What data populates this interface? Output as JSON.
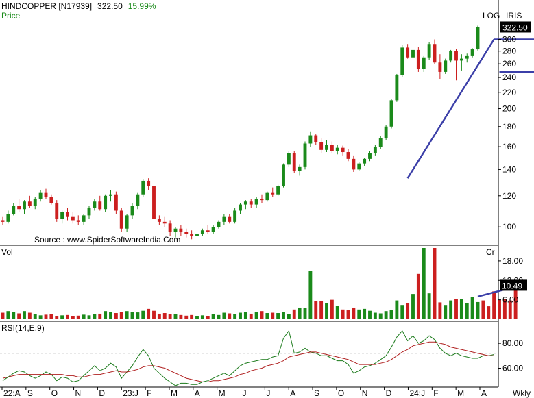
{
  "header": {
    "symbol": "HINDCOPPER [N17939]",
    "last_price": "322.50",
    "change_pct": "15.99%",
    "price_label": "Price",
    "log_label": "LOG",
    "iris_label": "IRIS"
  },
  "watermark": "Source : www.SpiderSoftwareIndia.Com",
  "colors": {
    "up": "#1a8a1a",
    "down": "#cc1f1f",
    "trend": "#3b3fa8",
    "rsi": "#1a7a1a",
    "rsi_avg": "#b02020",
    "badge": "#000000"
  },
  "chart_data": [
    {
      "type": "candlestick",
      "title": "HINDCOPPER [N17939]",
      "scale": "log",
      "ylim": [
        92,
        335
      ],
      "yticks": [
        "300",
        "280",
        "260",
        "240",
        "220",
        "200",
        "180",
        "160",
        "140",
        "120",
        "100"
      ],
      "last_value": "322.50",
      "time_labels": [
        "22:A",
        "S",
        "O",
        "N",
        "D",
        "23:J",
        "F",
        "M",
        "A",
        "M",
        "J",
        "J",
        "A",
        "S",
        "O",
        "N",
        "D",
        "24:J",
        "F",
        "M",
        "A"
      ],
      "x_unit": "Wkly",
      "bars": [
        [
          104,
          106,
          101,
          103
        ],
        [
          103,
          110,
          102,
          108
        ],
        [
          108,
          115,
          107,
          113
        ],
        [
          113,
          118,
          109,
          111
        ],
        [
          111,
          117,
          108,
          116
        ],
        [
          116,
          120,
          112,
          113
        ],
        [
          113,
          119,
          111,
          118
        ],
        [
          118,
          124,
          116,
          122
        ],
        [
          122,
          125,
          118,
          119
        ],
        [
          119,
          121,
          114,
          115
        ],
        [
          115,
          117,
          103,
          105
        ],
        [
          105,
          110,
          102,
          109
        ],
        [
          109,
          112,
          104,
          106
        ],
        [
          106,
          109,
          102,
          104
        ],
        [
          104,
          107,
          101,
          103
        ],
        [
          103,
          108,
          101,
          107
        ],
        [
          107,
          113,
          105,
          112
        ],
        [
          112,
          118,
          110,
          116
        ],
        [
          116,
          120,
          110,
          111
        ],
        [
          111,
          121,
          109,
          120
        ],
        [
          120,
          124,
          116,
          121
        ],
        [
          121,
          123,
          108,
          110
        ],
        [
          110,
          112,
          97,
          99
        ],
        [
          99,
          108,
          97,
          107
        ],
        [
          107,
          115,
          105,
          113
        ],
        [
          113,
          122,
          111,
          121
        ],
        [
          121,
          132,
          119,
          131
        ],
        [
          131,
          133,
          124,
          127
        ],
        [
          127,
          129,
          104,
          105
        ],
        [
          105,
          107,
          101,
          103
        ],
        [
          103,
          106,
          100,
          102
        ],
        [
          102,
          104,
          95,
          97
        ],
        [
          97,
          100,
          94,
          99
        ],
        [
          99,
          101,
          95,
          97
        ],
        [
          97,
          99,
          94,
          96
        ],
        [
          96,
          98,
          93,
          95
        ],
        [
          95,
          97,
          93,
          96
        ],
        [
          96,
          99,
          95,
          98
        ],
        [
          98,
          101,
          96,
          97
        ],
        [
          97,
          101,
          96,
          100
        ],
        [
          100,
          104,
          99,
          103
        ],
        [
          103,
          108,
          101,
          106
        ],
        [
          106,
          108,
          102,
          103
        ],
        [
          103,
          112,
          102,
          110
        ],
        [
          110,
          115,
          108,
          114
        ],
        [
          114,
          117,
          111,
          116
        ],
        [
          116,
          118,
          112,
          114
        ],
        [
          114,
          119,
          112,
          118
        ],
        [
          118,
          121,
          115,
          117
        ],
        [
          117,
          123,
          116,
          122
        ],
        [
          122,
          126,
          119,
          121
        ],
        [
          121,
          128,
          120,
          127
        ],
        [
          127,
          145,
          126,
          144
        ],
        [
          144,
          156,
          142,
          154
        ],
        [
          154,
          156,
          137,
          139
        ],
        [
          139,
          144,
          135,
          142
        ],
        [
          142,
          165,
          140,
          163
        ],
        [
          163,
          175,
          160,
          171
        ],
        [
          171,
          172,
          162,
          164
        ],
        [
          164,
          168,
          154,
          157
        ],
        [
          157,
          166,
          155,
          162
        ],
        [
          162,
          165,
          154,
          156
        ],
        [
          156,
          162,
          153,
          159
        ],
        [
          159,
          161,
          152,
          155
        ],
        [
          155,
          158,
          147,
          149
        ],
        [
          149,
          152,
          138,
          140
        ],
        [
          140,
          146,
          139,
          145
        ],
        [
          145,
          150,
          143,
          149
        ],
        [
          149,
          156,
          147,
          154
        ],
        [
          154,
          162,
          152,
          160
        ],
        [
          160,
          170,
          158,
          168
        ],
        [
          168,
          182,
          166,
          180
        ],
        [
          180,
          212,
          178,
          210
        ],
        [
          210,
          245,
          208,
          243
        ],
        [
          243,
          290,
          241,
          286
        ],
        [
          286,
          292,
          268,
          270
        ],
        [
          270,
          285,
          262,
          282
        ],
        [
          282,
          287,
          248,
          252
        ],
        [
          252,
          272,
          248,
          270
        ],
        [
          270,
          295,
          266,
          292
        ],
        [
          292,
          300,
          260,
          262
        ],
        [
          262,
          275,
          238,
          248
        ],
        [
          248,
          268,
          245,
          265
        ],
        [
          265,
          282,
          262,
          280
        ],
        [
          280,
          284,
          236,
          265
        ],
        [
          265,
          275,
          250,
          268
        ],
        [
          268,
          276,
          262,
          272
        ],
        [
          272,
          285,
          270,
          283
        ],
        [
          283,
          325,
          281,
          322
        ]
      ],
      "trendlines": [
        {
          "from": [
            75,
            133
          ],
          "to": [
            91,
            300
          ]
        },
        {
          "from": [
            91,
            300
          ],
          "to": [
            109,
            300
          ]
        },
        {
          "from": [
            92,
            248
          ],
          "to": [
            109,
            248
          ]
        }
      ]
    },
    {
      "type": "bar",
      "title": "Vol",
      "right_label": "Cr",
      "ylim": [
        0,
        22
      ],
      "yticks": [
        "18.00",
        "12.00",
        "6.00"
      ],
      "last_value": "10.49",
      "values": [
        2.0,
        2.5,
        2.2,
        1.8,
        2.5,
        2.0,
        1.5,
        1.2,
        1.4,
        1.5,
        1.0,
        1.2,
        1.3,
        1.0,
        1.1,
        1.4,
        1.2,
        1.6,
        1.7,
        2.5,
        2.2,
        1.9,
        2.3,
        2.5,
        2.2,
        2.1,
        2.6,
        3.2,
        2.6,
        1.7,
        1.9,
        1.5,
        1.6,
        1.3,
        1.1,
        1.3,
        1.0,
        1.2,
        1.0,
        1.5,
        1.3,
        2.0,
        1.8,
        1.6,
        2.0,
        2.2,
        1.7,
        2.2,
        2.5,
        1.9,
        2.0,
        1.9,
        2.2,
        1.5,
        3.0,
        3.6,
        3.5,
        15.0,
        5.5,
        5.5,
        5.0,
        6.0,
        4.2,
        3.0,
        2.8,
        3.6,
        3.0,
        3.2,
        2.6,
        2.0,
        1.8,
        2.5,
        2.8,
        5.8,
        4.4,
        4.9,
        7.8,
        14.0,
        24.5,
        8.0,
        23.5,
        5.2,
        4.4,
        5.8,
        6.3,
        6.3,
        5.0,
        6.8,
        5.3,
        5.8,
        4.0,
        8.6,
        6.0,
        6.2,
        5.8,
        10.49
      ],
      "trendline": {
        "from": [
          88,
          7.0
        ],
        "to": [
          96,
          10.5
        ]
      }
    },
    {
      "type": "line",
      "title": "RSI(14,E,9)",
      "ylim": [
        46,
        96
      ],
      "yticks": [
        "80.00",
        "60.00"
      ],
      "reference_line": 72,
      "series": [
        {
          "values": [
            50,
            53,
            56,
            58,
            57,
            54,
            52,
            54,
            57,
            55,
            50,
            53,
            52,
            49,
            50,
            54,
            58,
            62,
            58,
            60,
            64,
            61,
            52,
            57,
            62,
            69,
            75,
            70,
            60,
            56,
            52,
            49,
            46,
            48,
            48,
            47,
            47,
            49,
            50,
            52,
            54,
            56,
            54,
            58,
            62,
            64,
            65,
            66,
            67,
            67,
            69,
            70,
            84,
            90,
            72,
            73,
            76,
            73,
            72,
            70,
            70,
            68,
            66,
            66,
            63,
            56,
            58,
            61,
            62,
            64,
            67,
            70,
            77,
            85,
            90,
            82,
            86,
            80,
            82,
            86,
            83,
            76,
            72,
            70,
            72,
            70,
            69,
            68,
            68,
            70,
            70,
            71
          ]
        },
        {
          "values": [
            52,
            53,
            54,
            55,
            55,
            55,
            55,
            55,
            55,
            55,
            55,
            55,
            54,
            54,
            53,
            53,
            54,
            55,
            55,
            56,
            57,
            58,
            57,
            57,
            58,
            59,
            61,
            62,
            62,
            61,
            60,
            58,
            56,
            54,
            52,
            51,
            50,
            49,
            49,
            50,
            50,
            51,
            52,
            53,
            55,
            56,
            58,
            59,
            60,
            62,
            63,
            64,
            66,
            69,
            70,
            71,
            72,
            73,
            73,
            72,
            71,
            70,
            69,
            68,
            67,
            65,
            63,
            63,
            63,
            63,
            64,
            65,
            67,
            70,
            73,
            75,
            78,
            79,
            80,
            81,
            81,
            80,
            79,
            77,
            76,
            75,
            74,
            73,
            72,
            71,
            70,
            70
          ]
        }
      ]
    }
  ]
}
